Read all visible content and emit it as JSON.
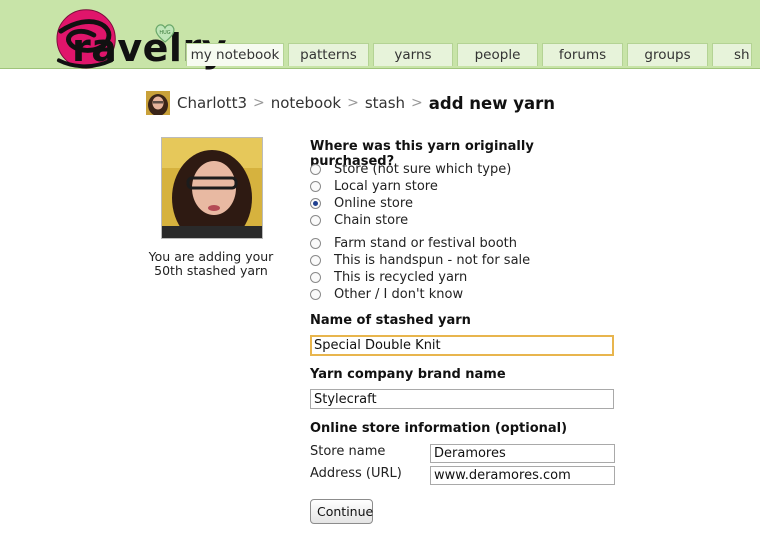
{
  "brand": {
    "logo_text": "ravelry",
    "hug_badge": "HUG",
    "logo_color": "#e0156b",
    "header_color": "#c8e4a8"
  },
  "nav": {
    "tabs": [
      {
        "label": "my notebook",
        "active": true
      },
      {
        "label": "patterns"
      },
      {
        "label": "yarns"
      },
      {
        "label": "people"
      },
      {
        "label": "forums"
      },
      {
        "label": "groups"
      },
      {
        "label": "sh"
      }
    ]
  },
  "breadcrumb": {
    "user": "Charlott3",
    "separator": ">",
    "notebook": "notebook",
    "stash": "stash",
    "current": "add new yarn"
  },
  "profile": {
    "caption_line1": "You are adding your",
    "caption_line2": "50th stashed yarn"
  },
  "form": {
    "purchase_question": "Where was this yarn originally purchased?",
    "purchase_options": [
      {
        "label": "Store (not sure which type)",
        "checked": false
      },
      {
        "label": "Local yarn store",
        "checked": false
      },
      {
        "label": "Online store",
        "checked": true
      },
      {
        "label": "Chain store",
        "checked": false
      },
      {
        "label": "Farm stand or festival booth",
        "checked": false
      },
      {
        "label": "This is handspun - not for sale",
        "checked": false
      },
      {
        "label": "This is recycled yarn",
        "checked": false
      },
      {
        "label": "Other / I don't know",
        "checked": false
      }
    ],
    "name_label": "Name of stashed yarn",
    "name_value": "Special Double Knit",
    "brand_label": "Yarn company brand name",
    "brand_value": "Stylecraft",
    "online_label": "Online store information (optional)",
    "store_name_label": "Store name",
    "store_name_value": "Deramores",
    "address_label": "Address (URL)",
    "address_value": "www.deramores.com",
    "continue_label": "Continue"
  }
}
